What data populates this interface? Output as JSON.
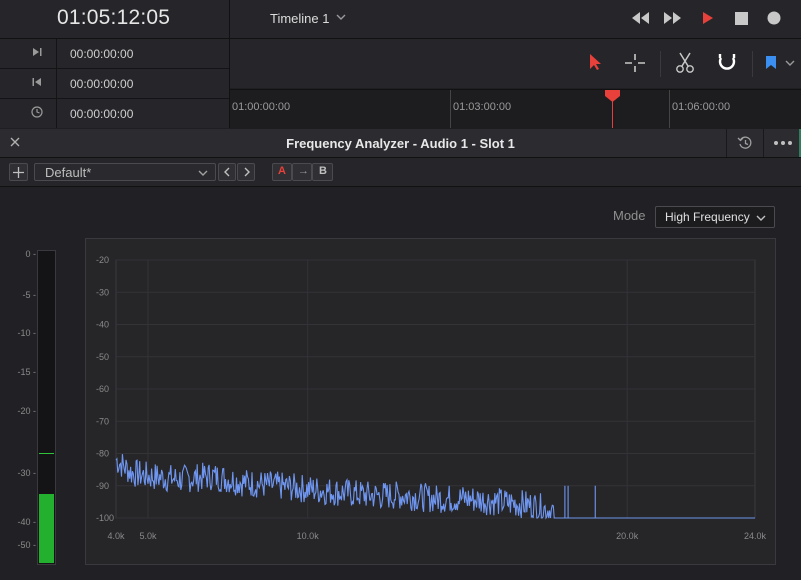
{
  "timecode_panel": {
    "main": "01:05:12:05",
    "rows": [
      {
        "icon": "mark-in-icon",
        "value": "00:00:00:00"
      },
      {
        "icon": "mark-out-icon",
        "value": "00:00:00:00"
      },
      {
        "icon": "duration-clock-icon",
        "value": "00:00:00:00"
      }
    ]
  },
  "timeline": {
    "title": "Timeline 1",
    "ruler_labels": [
      "01:00:00:00",
      "01:03:00:00",
      "01:06:00:00"
    ]
  },
  "transport_icons": [
    "rewind-icon",
    "fast-forward-icon",
    "play-icon",
    "stop-icon",
    "record-icon"
  ],
  "tool_icons": [
    "selection-arrow-icon",
    "trim-crosshair-icon",
    "blade-scissors-icon",
    "snapping-magnet-icon",
    "flag-marker-icon"
  ],
  "colors": {
    "accent_red": "#e8403a",
    "marker_blue": "#3a8ff0",
    "spectrum_line": "#6f96f0",
    "meter_green": "#22b02e"
  },
  "plugin": {
    "title": "Frequency Analyzer - Audio 1 -  Slot 1",
    "preset": "Default*",
    "ab": {
      "a": "A",
      "arrow": "→",
      "b": "B"
    },
    "mode_label": "Mode",
    "mode_value": "High Frequency"
  },
  "meter": {
    "ticks": [
      "0",
      "-5",
      "-10",
      "-15",
      "-20",
      "-30",
      "-40",
      "-50"
    ],
    "level_fraction": 0.22,
    "peak_fraction": 0.35
  },
  "chart_data": {
    "type": "line",
    "y_ticks": [
      -20,
      -30,
      -40,
      -50,
      -60,
      -70,
      -80,
      -90,
      -100
    ],
    "ylim": [
      -100,
      -20
    ],
    "x_ticks": [
      "4.0k",
      "5.0k",
      "10.0k",
      "20.0k",
      "24.0k"
    ],
    "xlim": [
      4000,
      24000
    ],
    "grid": true,
    "series": [
      {
        "x": [
          4000,
          4500,
          5000,
          6000,
          7000,
          8000,
          9000,
          10000,
          11000,
          12000,
          13000,
          14000,
          15000,
          16000,
          17000,
          17700,
          17800,
          18000,
          18500,
          19000,
          19400,
          19500,
          20000,
          22000,
          24000
        ],
        "y": [
          -82,
          -86,
          -87,
          -88,
          -87,
          -89,
          -90,
          -91,
          -92,
          -93,
          -93,
          -94,
          -94,
          -95,
          -96,
          -98,
          -100,
          -100,
          -100,
          -100,
          -100,
          -100,
          -100,
          -100,
          -100
        ]
      }
    ]
  }
}
